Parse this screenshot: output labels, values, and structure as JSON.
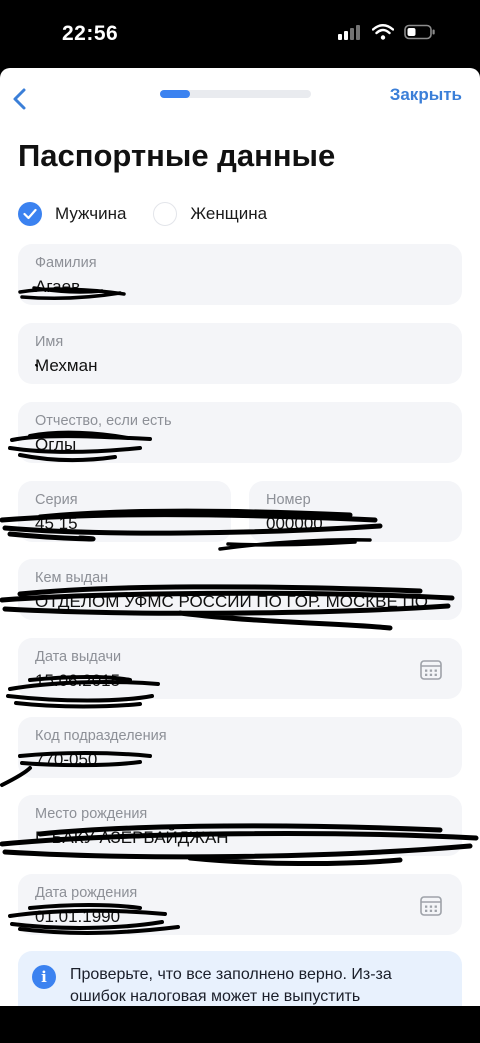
{
  "status": {
    "time": "22:56"
  },
  "nav": {
    "close_label": "Закрыть",
    "progress": 0.2
  },
  "title": "Паспортные данные",
  "gender": [
    {
      "label": "Мужчина",
      "selected": true
    },
    {
      "label": "Женщина",
      "selected": false
    }
  ],
  "fields": {
    "surname": {
      "label": "Фамилия",
      "value": "Агаев"
    },
    "name": {
      "label": "Имя",
      "value": "Мехман"
    },
    "patronymic": {
      "label": "Отчество, если есть",
      "value": "Оглы"
    },
    "series": {
      "label": "Серия",
      "value": "45 15"
    },
    "number": {
      "label": "Номер",
      "value": "000000"
    },
    "issued_by": {
      "label": "Кем выдан",
      "value": "ОТДЕЛОМ УФМС РОССИИ ПО ГОР. МОСКВЕ ПО"
    },
    "issue_date": {
      "label": "Дата выдачи",
      "value": "15.06.2015"
    },
    "division_code": {
      "label": "Код подразделения",
      "value": "770-050"
    },
    "birth_place": {
      "label": "Место рождения",
      "value": "Г. БАКУ АЗЕРБАЙДЖАН"
    },
    "birth_date": {
      "label": "Дата рождения",
      "value": "01.01.1990"
    }
  },
  "info": {
    "icon": "info-icon",
    "text": "Проверьте, что все заполнено верно. Из-за ошибок налоговая может не выпустить"
  },
  "colors": {
    "accent": "#3b82f0",
    "link": "#3b7fd8",
    "field_bg": "#f4f5f8",
    "info_bg": "#e8f1fd"
  }
}
